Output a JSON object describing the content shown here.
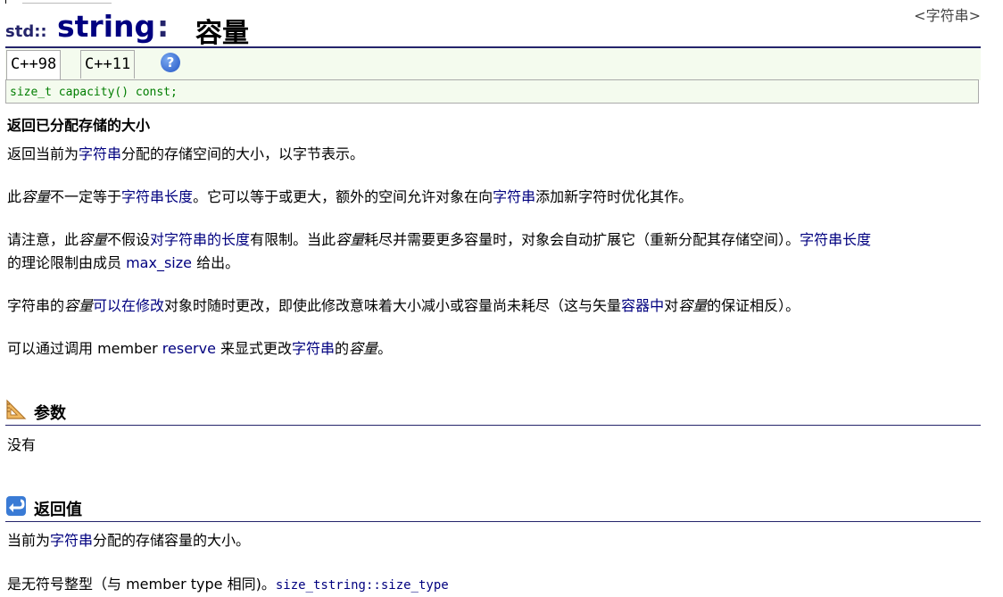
{
  "header": {
    "ns": "std::",
    "class_name": "string",
    "colon": ":",
    "function_name": "容量",
    "header_link": "<字符串>"
  },
  "tabs": [
    {
      "label": "C++98"
    },
    {
      "label": "C++11"
    }
  ],
  "help_icon": "?",
  "prototype": "size_t capacity() const;",
  "summary": "返回已分配存储的大小",
  "p1": {
    "a": "返回当前为",
    "link": "字符串",
    "b": "分配的存储空间的大小，以字节表示。"
  },
  "p2": {
    "a": "此",
    "i1": "容量",
    "b": "不一定等于",
    "link1": "字符串长度",
    "c": "。它可以等于或更大，额外的空间允许对象在向",
    "link2": "字符串",
    "d": "添加新字符时优化其作。"
  },
  "p3": {
    "a": "请注意，此",
    "i1": "容量",
    "b": "不假设",
    "link1": "对字符串的长度",
    "c": "有限制。当此",
    "i2": "容量",
    "d": "耗尽并需要更多容量时，对象会自动扩展它（重新分配其存储空间）。",
    "link2": "字符串长度"
  },
  "p3b": {
    "a": "的理论限制由成员 ",
    "link": "max_size",
    "b": " 给出。"
  },
  "p4": {
    "a": "字符串的",
    "i1": "容量",
    "link1": "可以在修改",
    "b": "对象时随时更改，即使此修改意味着大小减小或容量尚未耗尽（这与矢量",
    "link2": "容器中",
    "c": "对",
    "i2": "容量",
    "d": "的保证相反）。"
  },
  "p5": {
    "a": "可以通过调用 member ",
    "link1": "reserve",
    "b": " 来显式更改",
    "link2": "字符串",
    "c": "的",
    "i1": "容量",
    "d": "。"
  },
  "params": {
    "title": "参数",
    "icon": "triangle-ruler-icon",
    "body": "没有"
  },
  "retval": {
    "title": "返回值",
    "icon": "return-arrow-icon",
    "line1": {
      "a": "当前为",
      "link": "字符串",
      "b": "分配的存储容量的大小。"
    },
    "line2": {
      "a": "是无符号整型（与 member type 相同)。",
      "code": "size_tstring::size_type"
    }
  },
  "colors": {
    "link": "#00007f",
    "title": "#000080",
    "code": "#007d00",
    "tab_bg": "#f4fbee"
  }
}
